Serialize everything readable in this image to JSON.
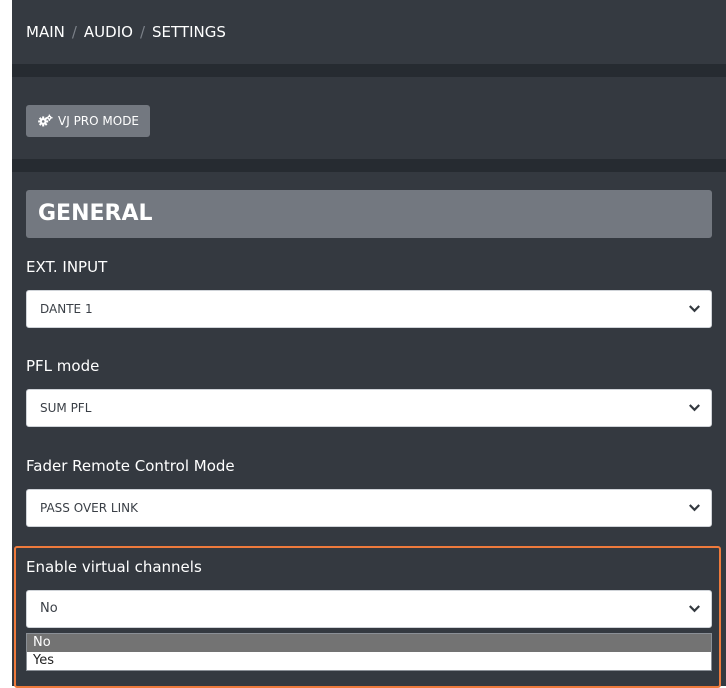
{
  "breadcrumb": {
    "items": [
      "MAIN",
      "AUDIO",
      "SETTINGS"
    ],
    "separator": "/"
  },
  "mode_button": {
    "label": "VJ PRO MODE",
    "icon": "gears-icon"
  },
  "general": {
    "title": "GENERAL",
    "fields": [
      {
        "label": "EXT. INPUT",
        "value": "DANTE 1"
      },
      {
        "label": "PFL mode",
        "value": "SUM PFL"
      },
      {
        "label": "Fader Remote Control Mode",
        "value": "PASS OVER LINK"
      },
      {
        "label": "Enable virtual channels",
        "value": "No"
      }
    ]
  },
  "virtual_channels_dropdown": {
    "open": true,
    "options": [
      "No",
      "Yes"
    ],
    "selected": "No"
  },
  "colors": {
    "page_background": "#262b31",
    "panel_background": "#343940",
    "button_background": "#737880",
    "highlight_border": "#ee7a3c",
    "selected_option": "#737373"
  }
}
